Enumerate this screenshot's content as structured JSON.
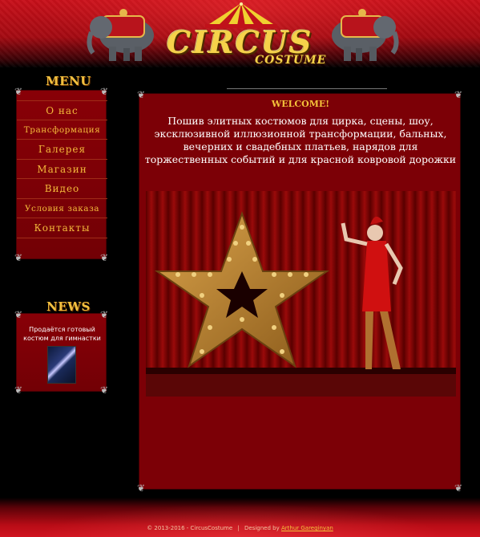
{
  "header": {
    "logo_title": "CIRCUS",
    "logo_subtitle": "COSTUME"
  },
  "menu": {
    "heading": "MENU",
    "items": [
      {
        "label": "О нас"
      },
      {
        "label": "Трансформация"
      },
      {
        "label": "Галерея"
      },
      {
        "label": "Магазин"
      },
      {
        "label": "Видео"
      },
      {
        "label": "Условия заказа"
      },
      {
        "label": "Контакты"
      }
    ]
  },
  "news": {
    "heading": "NEWS",
    "text": "Продаётся готовый костюм для гимнастки"
  },
  "main": {
    "title": "WELCOME!",
    "text": "Пошив элитных костюмов для цирка, сцены, шоу, эксклюзивной иллюзионной трансформации, бальных, вечерних и свадебных платьев, нарядов для торжественных событий и для красной ковровой дорожки"
  },
  "footer": {
    "copyright": "© 2013-2016 - CircusCostume",
    "separator": "|",
    "designed_by_prefix": "Designed by",
    "designer": "Arthur Gareginyan"
  },
  "colors": {
    "brand_red": "#7c0006",
    "menu_gold": "#f3b93b",
    "logo_gold": "#f6d24a"
  }
}
